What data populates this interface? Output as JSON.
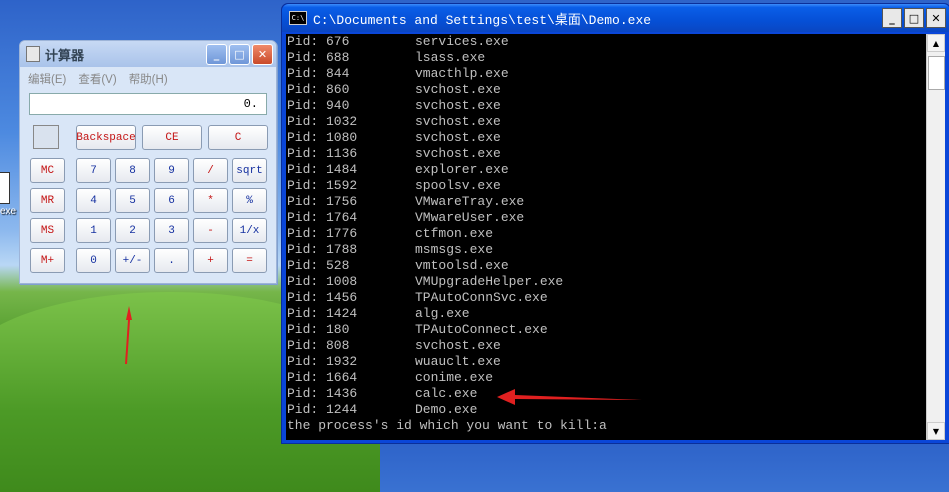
{
  "calculator": {
    "title": "计算器",
    "menu": [
      "编辑(E)",
      "查看(V)",
      "帮助(H)"
    ],
    "display": "0.",
    "buttons": {
      "backspace": "Backspace",
      "ce": "CE",
      "c": "C",
      "mc": "MC",
      "mr": "MR",
      "ms": "MS",
      "mplus": "M+",
      "b7": "7",
      "b8": "8",
      "b9": "9",
      "div": "/",
      "sqrt": "sqrt",
      "b4": "4",
      "b5": "5",
      "b6": "6",
      "mul": "*",
      "pct": "%",
      "b1": "1",
      "b2": "2",
      "b3": "3",
      "sub": "-",
      "inv": "1/x",
      "b0": "0",
      "sign": "+/-",
      "dot": ".",
      "add": "+",
      "eq": "="
    }
  },
  "console": {
    "title": "C:\\Documents and Settings\\test\\桌面\\Demo.exe",
    "processes": [
      {
        "pid": "Pid: 676",
        "name": "services.exe"
      },
      {
        "pid": "Pid: 688",
        "name": "lsass.exe"
      },
      {
        "pid": "Pid: 844",
        "name": "vmacthlp.exe"
      },
      {
        "pid": "Pid: 860",
        "name": "svchost.exe"
      },
      {
        "pid": "Pid: 940",
        "name": "svchost.exe"
      },
      {
        "pid": "Pid: 1032",
        "name": "svchost.exe"
      },
      {
        "pid": "Pid: 1080",
        "name": "svchost.exe"
      },
      {
        "pid": "Pid: 1136",
        "name": "svchost.exe"
      },
      {
        "pid": "Pid: 1484",
        "name": "explorer.exe"
      },
      {
        "pid": "Pid: 1592",
        "name": "spoolsv.exe"
      },
      {
        "pid": "Pid: 1756",
        "name": "VMwareTray.exe"
      },
      {
        "pid": "Pid: 1764",
        "name": "VMwareUser.exe"
      },
      {
        "pid": "Pid: 1776",
        "name": "ctfmon.exe"
      },
      {
        "pid": "Pid: 1788",
        "name": "msmsgs.exe"
      },
      {
        "pid": "Pid: 528",
        "name": "vmtoolsd.exe"
      },
      {
        "pid": "Pid: 1008",
        "name": "VMUpgradeHelper.exe"
      },
      {
        "pid": "Pid: 1456",
        "name": "TPAutoConnSvc.exe"
      },
      {
        "pid": "Pid: 1424",
        "name": "alg.exe"
      },
      {
        "pid": "Pid: 180",
        "name": "TPAutoConnect.exe"
      },
      {
        "pid": "Pid: 808",
        "name": "svchost.exe"
      },
      {
        "pid": "Pid: 1932",
        "name": "wuauclt.exe"
      },
      {
        "pid": "Pid: 1664",
        "name": "conime.exe"
      },
      {
        "pid": "Pid: 1436",
        "name": "calc.exe"
      },
      {
        "pid": "Pid: 1244",
        "name": "Demo.exe"
      }
    ],
    "prompt": "the process's id which you want to kill:a"
  },
  "desktop": {
    "icon_label": "exe"
  }
}
